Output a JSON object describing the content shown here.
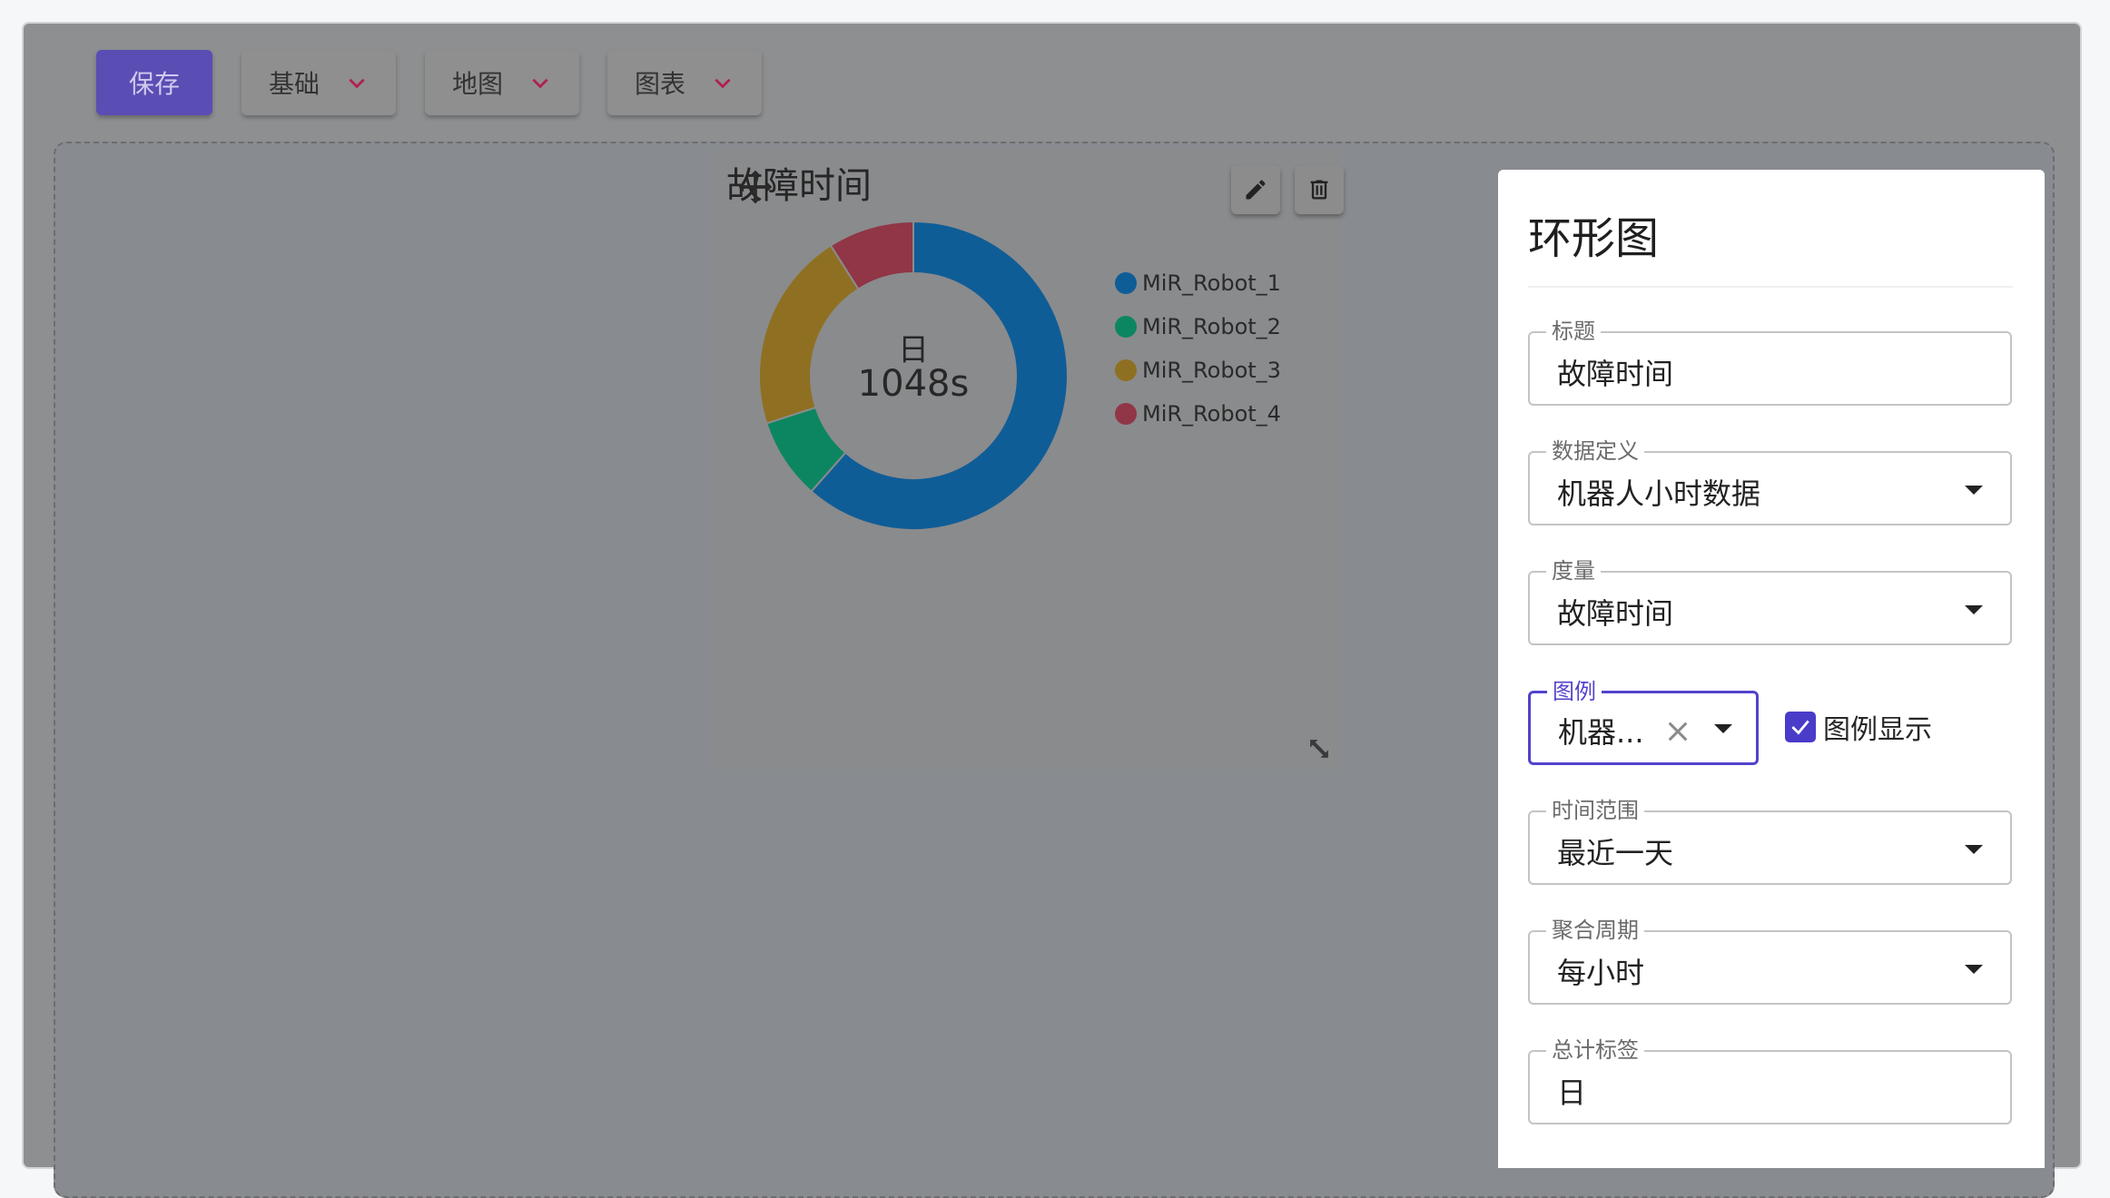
{
  "toolbar": {
    "save_label": "保存",
    "menus": [
      "基础",
      "地图",
      "图表"
    ]
  },
  "widget": {
    "title": "故障时间",
    "center_label": "日",
    "center_value": "1048s",
    "legend": [
      "MiR_Robot_1",
      "MiR_Robot_2",
      "MiR_Robot_3",
      "MiR_Robot_4"
    ]
  },
  "chart_data": {
    "type": "pie",
    "donut": true,
    "categories": [
      "MiR_Robot_1",
      "MiR_Robot_2",
      "MiR_Robot_3",
      "MiR_Robot_4"
    ],
    "values": [
      0.615,
      0.085,
      0.21,
      0.09
    ],
    "colors": [
      "#0f5d97",
      "#0c8661",
      "#8f7022",
      "#903646"
    ],
    "center_label": "日",
    "center_value": "1048s",
    "legend_position": "right"
  },
  "panel": {
    "title": "环形图",
    "fields": {
      "title_label": "标题",
      "title_value": "故障时间",
      "datadef_label": "数据定义",
      "datadef_value": "机器人小时数据",
      "metric_label": "度量",
      "metric_value": "故障时间",
      "legend_label": "图例",
      "legend_value": "机器...",
      "legend_show_label": "图例显示",
      "range_label": "时间范围",
      "range_value": "最近一天",
      "period_label": "聚合周期",
      "period_value": "每小时",
      "total_label": "总计标签",
      "total_value": "日"
    },
    "legend_show_checked": true
  },
  "colors": {
    "primary": "#5243cc",
    "save_button": "#5a4db4",
    "chevron": "#b02050"
  }
}
